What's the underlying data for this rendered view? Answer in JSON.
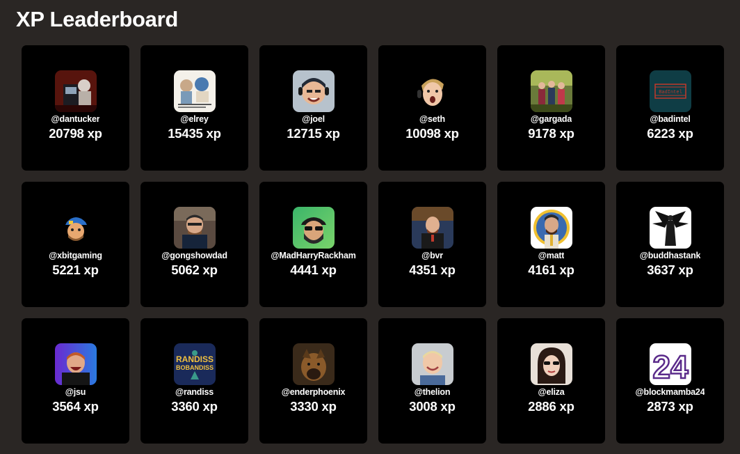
{
  "page": {
    "title": "XP Leaderboard"
  },
  "leaderboard": [
    {
      "handle": "@dantucker",
      "xp": "20798 xp",
      "avatar": "avatar-dantucker"
    },
    {
      "handle": "@elrey",
      "xp": "15435 xp",
      "avatar": "avatar-elrey"
    },
    {
      "handle": "@joel",
      "xp": "12715 xp",
      "avatar": "avatar-joel"
    },
    {
      "handle": "@seth",
      "xp": "10098 xp",
      "avatar": "avatar-seth"
    },
    {
      "handle": "@gargada",
      "xp": "9178 xp",
      "avatar": "avatar-gargada"
    },
    {
      "handle": "@badintel",
      "xp": "6223 xp",
      "avatar": "avatar-badintel"
    },
    {
      "handle": "@xbitgaming",
      "xp": "5221 xp",
      "avatar": "avatar-xbitgaming"
    },
    {
      "handle": "@gongshowdad",
      "xp": "5062 xp",
      "avatar": "avatar-gongshowdad"
    },
    {
      "handle": "@MadHarryRackham",
      "xp": "4441 xp",
      "avatar": "avatar-madharryrackham"
    },
    {
      "handle": "@bvr",
      "xp": "4351 xp",
      "avatar": "avatar-bvr"
    },
    {
      "handle": "@matt",
      "xp": "4161 xp",
      "avatar": "avatar-matt"
    },
    {
      "handle": "@buddhastank",
      "xp": "3637 xp",
      "avatar": "avatar-buddhastank"
    },
    {
      "handle": "@jsu",
      "xp": "3564 xp",
      "avatar": "avatar-jsu"
    },
    {
      "handle": "@randiss",
      "xp": "3360 xp",
      "avatar": "avatar-randiss"
    },
    {
      "handle": "@enderphoenix",
      "xp": "3330 xp",
      "avatar": "avatar-enderphoenix"
    },
    {
      "handle": "@thelion",
      "xp": "3008 xp",
      "avatar": "avatar-thelion"
    },
    {
      "handle": "@eliza",
      "xp": "2886 xp",
      "avatar": "avatar-eliza"
    },
    {
      "handle": "@blockmamba24",
      "xp": "2873 xp",
      "avatar": "avatar-blockmamba24"
    }
  ],
  "avatar_text": {
    "badintel": "BadIntel",
    "randiss_top": "RANDISS",
    "randiss_mid": "BOBANDISS",
    "blockmamba": "24"
  }
}
